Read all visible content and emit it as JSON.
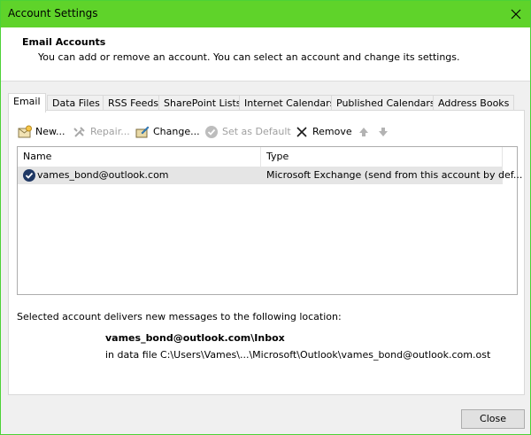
{
  "window": {
    "title": "Account Settings"
  },
  "header": {
    "title": "Email Accounts",
    "description": "You can add or remove an account. You can select an account and change its settings."
  },
  "tabs": [
    {
      "label": "Email",
      "active": true
    },
    {
      "label": "Data Files"
    },
    {
      "label": "RSS Feeds"
    },
    {
      "label": "SharePoint Lists"
    },
    {
      "label": "Internet Calendars"
    },
    {
      "label": "Published Calendars"
    },
    {
      "label": "Address Books"
    }
  ],
  "toolbar": {
    "new": "New...",
    "repair": "Repair...",
    "change": "Change...",
    "set_default": "Set as Default",
    "remove": "Remove"
  },
  "list": {
    "columns": [
      "Name",
      "Type"
    ],
    "rows": [
      {
        "name": "vames_bond@outlook.com",
        "type": "Microsoft Exchange (send from this account by def..."
      }
    ]
  },
  "delivery": {
    "label": "Selected account delivers new messages to the following location:",
    "inbox": "vames_bond@outlook.com\\Inbox",
    "file": "in data file C:\\Users\\Vames\\...\\Microsoft\\Outlook\\vames_bond@outlook.com.ost"
  },
  "footer": {
    "close": "Close"
  },
  "colors": {
    "titlebar": "#5fd32a",
    "selection": "#e5e5e5"
  }
}
